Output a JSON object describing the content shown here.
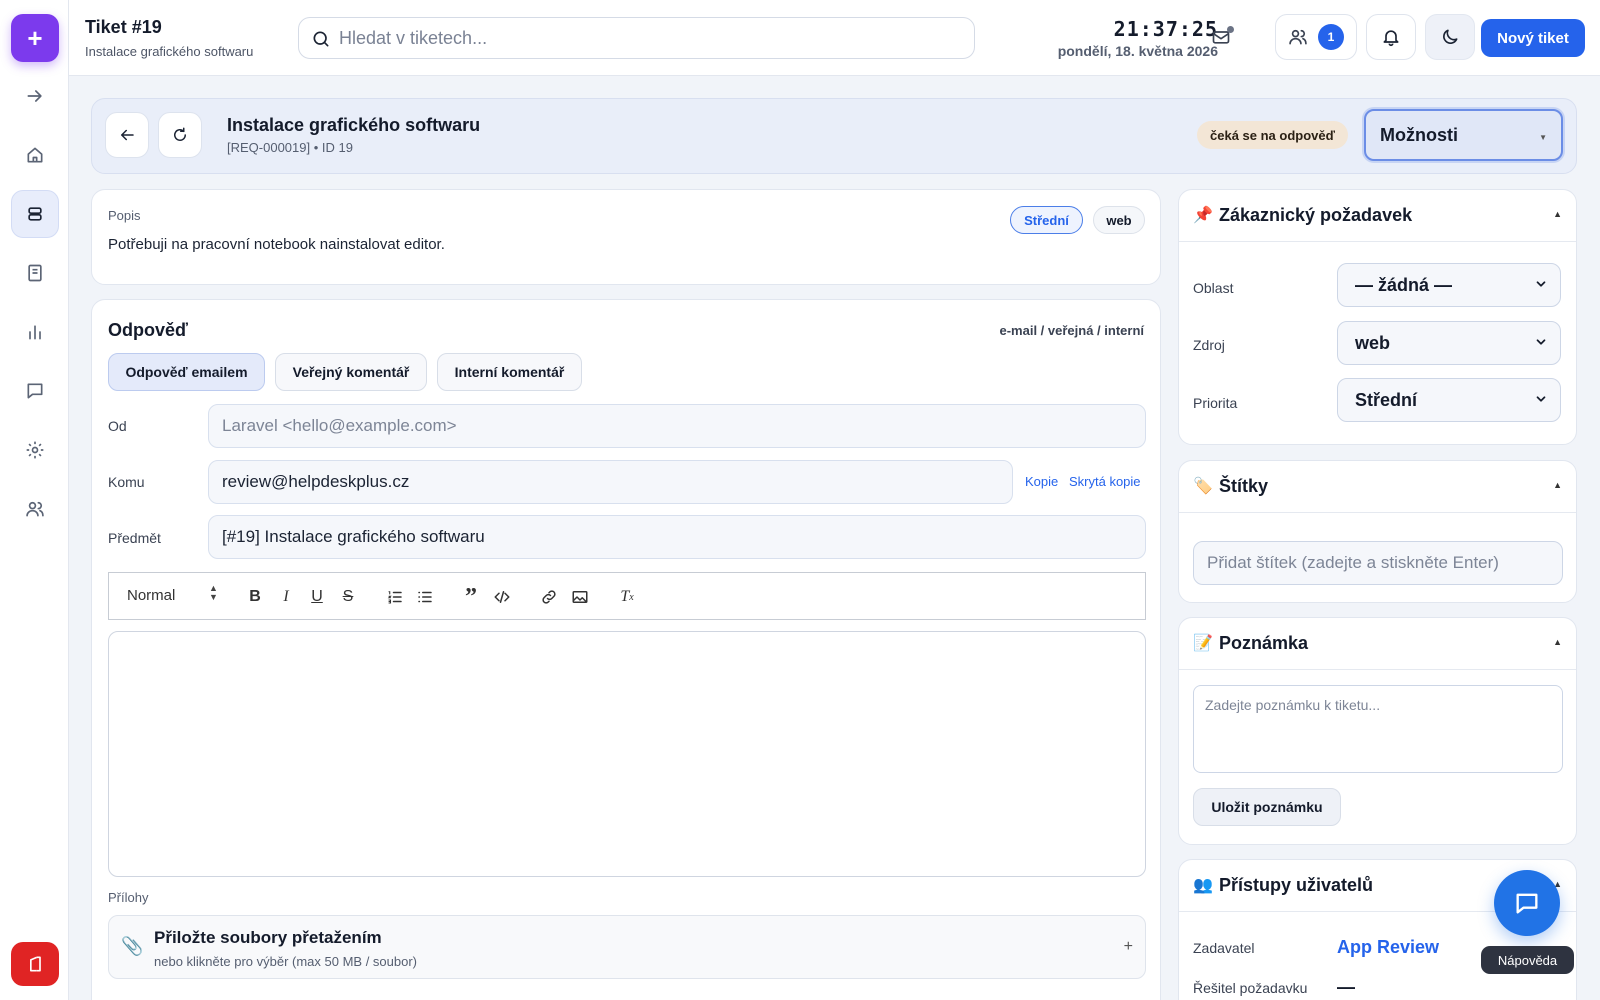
{
  "header": {
    "title": "Tiket #19",
    "subtitle": "Instalace grafického softwaru",
    "search_placeholder": "Hledat v tiketech...",
    "time": "21:37:25",
    "date": "pondělí, 18. května 2026",
    "users_count": "1",
    "new_ticket_label": "Nový tiket"
  },
  "ticket": {
    "title": "Instalace grafického softwaru",
    "ref": "[REQ-000019] • ID 19",
    "status": "čeká se na odpověď",
    "options_label": "Možnosti"
  },
  "description": {
    "label": "Popis",
    "text": "Potřebuji na pracovní notebook nainstalovat editor.",
    "priority_badge": "Střední",
    "source_badge": "web"
  },
  "reply": {
    "title": "Odpověď",
    "modes": "e-mail / veřejná / interní",
    "tabs": [
      "Odpověď emailem",
      "Veřejný komentář",
      "Interní komentář"
    ],
    "from_label": "Od",
    "from_value": "Laravel <hello@example.com>",
    "to_label": "Komu",
    "to_value": "review@helpdeskplus.cz",
    "cc_label": "Kopie",
    "bcc_label": "Skrytá kopie",
    "subject_label": "Předmět",
    "subject_value": "[#19] Instalace grafického softwaru",
    "format_value": "Normal",
    "attachments_label": "Přílohy",
    "drop_title": "Přiložte soubory přetažením",
    "drop_sub": "nebo klikněte pro výběr (max 50 MB / soubor)",
    "drop_plus": "+"
  },
  "customer_request": {
    "title": "Zákaznický požadavek",
    "fields": [
      {
        "label": "Oblast",
        "value": "— žádná —"
      },
      {
        "label": "Zdroj",
        "value": "web"
      },
      {
        "label": "Priorita",
        "value": "Střední"
      }
    ]
  },
  "tags": {
    "title": "Štítky",
    "placeholder": "Přidat štítek (zadejte a stiskněte Enter)"
  },
  "note": {
    "title": "Poznámka",
    "placeholder": "Zadejte poznámku k tiketu...",
    "save_label": "Uložit poznámku"
  },
  "access": {
    "title": "Přístupy uživatelů",
    "requester_label": "Zadavatel",
    "requester_value": "App Review",
    "assignee_label": "Řešitel požadavku",
    "assignee_value": "—"
  },
  "help_label": "Nápověda",
  "icons": {
    "panel_pin": "📌",
    "panel_tag": "🏷️",
    "panel_note": "📝",
    "panel_users": "👥",
    "attach": "📎"
  },
  "colors": {
    "accent": "#2563eb",
    "plus_button": "#7c3aed",
    "logout": "#e02424",
    "status_badge": "#f3e6d6"
  }
}
